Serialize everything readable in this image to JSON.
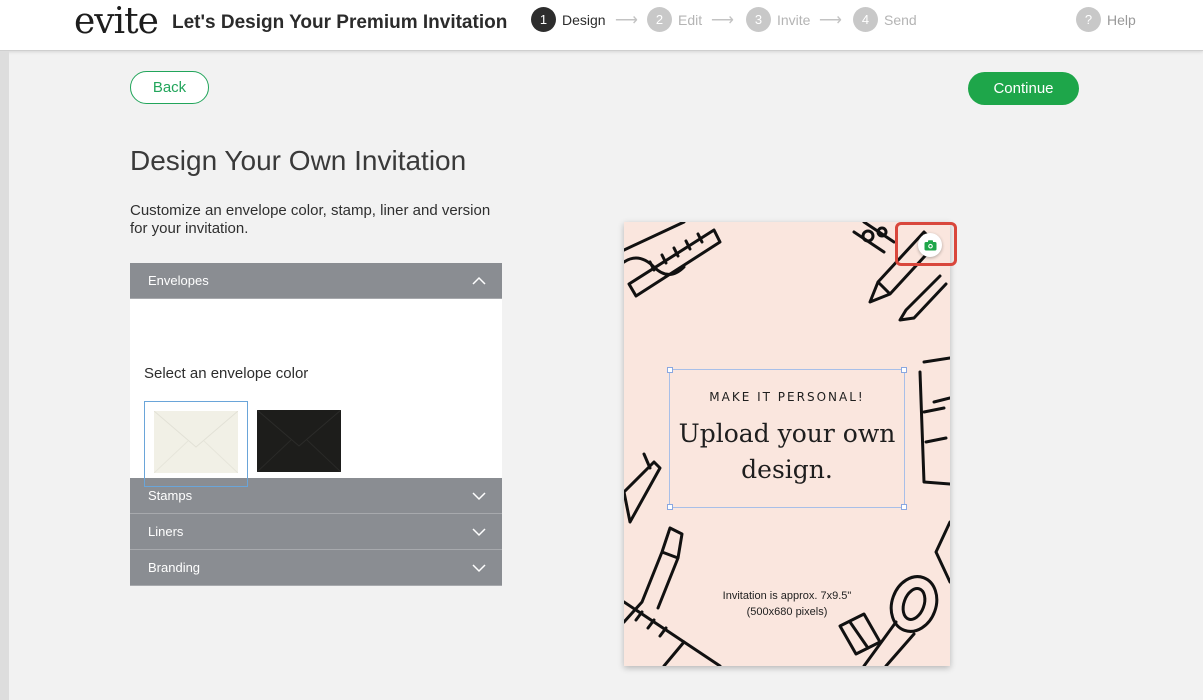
{
  "header": {
    "logo": "evite",
    "title": "Let's Design Your Premium Invitation",
    "steps": [
      {
        "num": "1",
        "label": "Design",
        "active": true
      },
      {
        "num": "2",
        "label": "Edit",
        "active": false
      },
      {
        "num": "3",
        "label": "Invite",
        "active": false
      },
      {
        "num": "4",
        "label": "Send",
        "active": false
      }
    ],
    "help": {
      "icon": "?",
      "label": "Help"
    }
  },
  "actions": {
    "back_label": "Back",
    "continue_label": "Continue"
  },
  "main": {
    "heading": "Design Your Own Invitation",
    "description": "Customize an envelope color, stamp, liner and version for your invitation."
  },
  "accordion": {
    "sections": [
      {
        "label": "Envelopes",
        "expanded": true
      },
      {
        "label": "Stamps",
        "expanded": false
      },
      {
        "label": "Liners",
        "expanded": false
      },
      {
        "label": "Branding",
        "expanded": false
      }
    ],
    "envelopes": {
      "prompt": "Select an envelope color",
      "colors": [
        {
          "name": "ivory",
          "hex": "#f1f0e6",
          "selected": true
        },
        {
          "name": "black",
          "hex": "#1d1d1b",
          "selected": false
        }
      ]
    }
  },
  "preview": {
    "tagline": "MAKE IT PERSONAL!",
    "headline_1": "Upload your own",
    "headline_2": "design.",
    "size_line_1": "Invitation is approx. 7x9.5\"",
    "size_line_2": "(500x680 pixels)",
    "upload_icon": "camera-icon"
  },
  "colors": {
    "accent_green": "#1ea64a",
    "panel_gray": "#8a8d92",
    "card_bg": "#fae6de",
    "highlight_red": "#d9473c"
  }
}
